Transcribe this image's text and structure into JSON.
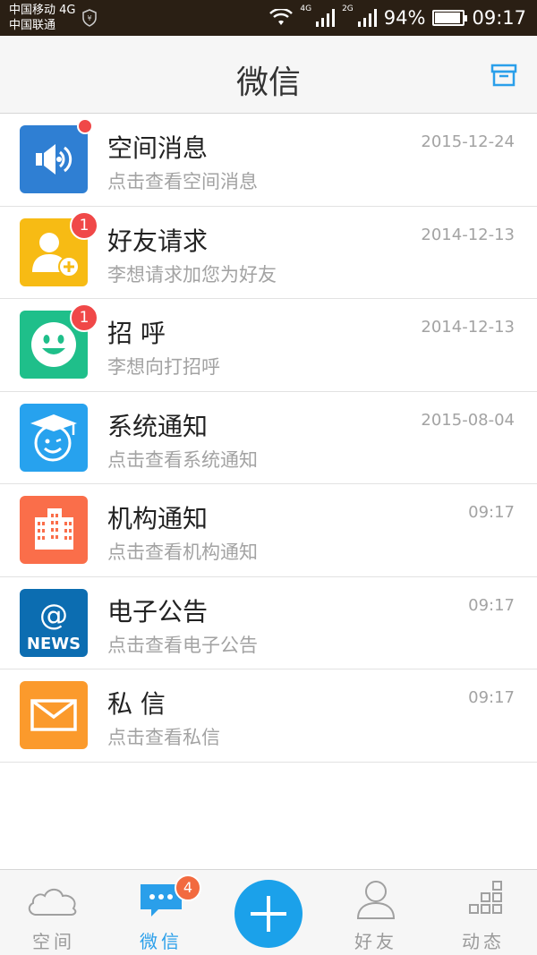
{
  "status_bar": {
    "carrier_1": "中国移动 4G",
    "carrier_2": "中国联通",
    "net_4g": "4G",
    "net_2g": "2G",
    "battery_percent": "94%",
    "battery_level": 0.94,
    "time": "09:17",
    "icons": [
      "shield-icon",
      "wifi-icon",
      "signal-icon",
      "signal-icon",
      "battery-icon"
    ]
  },
  "header": {
    "title": "微信",
    "action_icon": "archive-icon"
  },
  "messages": [
    {
      "title": "空间消息",
      "subtitle": "点击查看空间消息",
      "date": "2015-12-24",
      "icon": "speaker-icon",
      "color": "#2f7fd3",
      "unread_dot": true,
      "badge": ""
    },
    {
      "title": "好友请求",
      "subtitle": "李想请求加您为好友",
      "date": "2014-12-13",
      "icon": "add-friend-icon",
      "color": "#f7bb14",
      "unread_dot": false,
      "badge": "1"
    },
    {
      "title": "招 呼",
      "subtitle": "李想向打招呼",
      "date": "2014-12-13",
      "icon": "smiley-icon",
      "color": "#1fbf8a",
      "unread_dot": false,
      "badge": "1"
    },
    {
      "title": "系统通知",
      "subtitle": "点击查看系统通知",
      "date": "2015-08-04",
      "icon": "graduate-icon",
      "color": "#27a2ee",
      "unread_dot": false,
      "badge": ""
    },
    {
      "title": "机构通知",
      "subtitle": "点击查看机构通知",
      "date": "09:17",
      "icon": "building-icon",
      "color": "#fa6e4a",
      "unread_dot": false,
      "badge": ""
    },
    {
      "title": "电子公告",
      "subtitle": "点击查看电子公告",
      "date": "09:17",
      "icon": "news-icon",
      "color": "#0c6db1",
      "unread_dot": false,
      "badge": "",
      "icon_text_1": "@",
      "icon_text_2": "NEWS"
    },
    {
      "title": "私 信",
      "subtitle": "点击查看私信",
      "date": "09:17",
      "icon": "mail-icon",
      "color": "#fb9a2c",
      "unread_dot": false,
      "badge": ""
    }
  ],
  "tabbar": {
    "tabs": [
      {
        "label": "空间",
        "icon": "cloud-icon",
        "active": false
      },
      {
        "label": "微信",
        "icon": "chat-icon",
        "active": true,
        "badge": "4"
      },
      {
        "label": "好友",
        "icon": "person-icon",
        "active": false
      },
      {
        "label": "动态",
        "icon": "grid-icon",
        "active": false
      }
    ],
    "add_icon": "plus-icon"
  },
  "colors": {
    "accent": "#2a9fea",
    "badge_red": "#f04848",
    "tab_badge": "#f26a3f",
    "status_bar": "#2a1f14"
  }
}
